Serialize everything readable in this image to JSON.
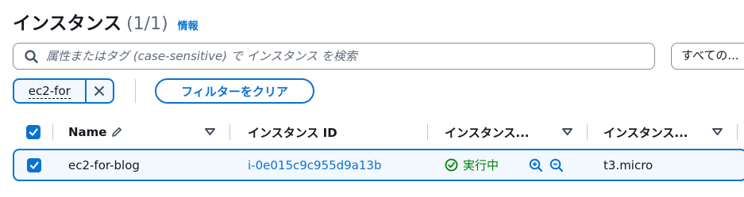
{
  "header": {
    "title": "インスタンス",
    "count": "(1/1)",
    "info_link": "情報"
  },
  "search": {
    "placeholder": "属性またはタグ (case-sensitive) で インスタンス を検索"
  },
  "state_filter": {
    "selected": "すべての..."
  },
  "filter_token": {
    "label": "ec2-for"
  },
  "clear_filters_label": "フィルターをクリア",
  "table": {
    "columns": [
      {
        "label": "Name"
      },
      {
        "label": "インスタンス ID"
      },
      {
        "label": "インスタンス..."
      },
      {
        "label": "インスタンス..."
      }
    ],
    "rows": [
      {
        "name": "ec2-for-blog",
        "instance_id": "i-0e015c9c955d9a13b",
        "state": "実行中",
        "instance_type": "t3.micro",
        "selected": true
      }
    ]
  },
  "colors": {
    "accent": "#0972d3",
    "running": "#037f0c",
    "text": "#16191f",
    "muted": "#5f6b7a",
    "selected_bg": "#f2f8fd"
  }
}
